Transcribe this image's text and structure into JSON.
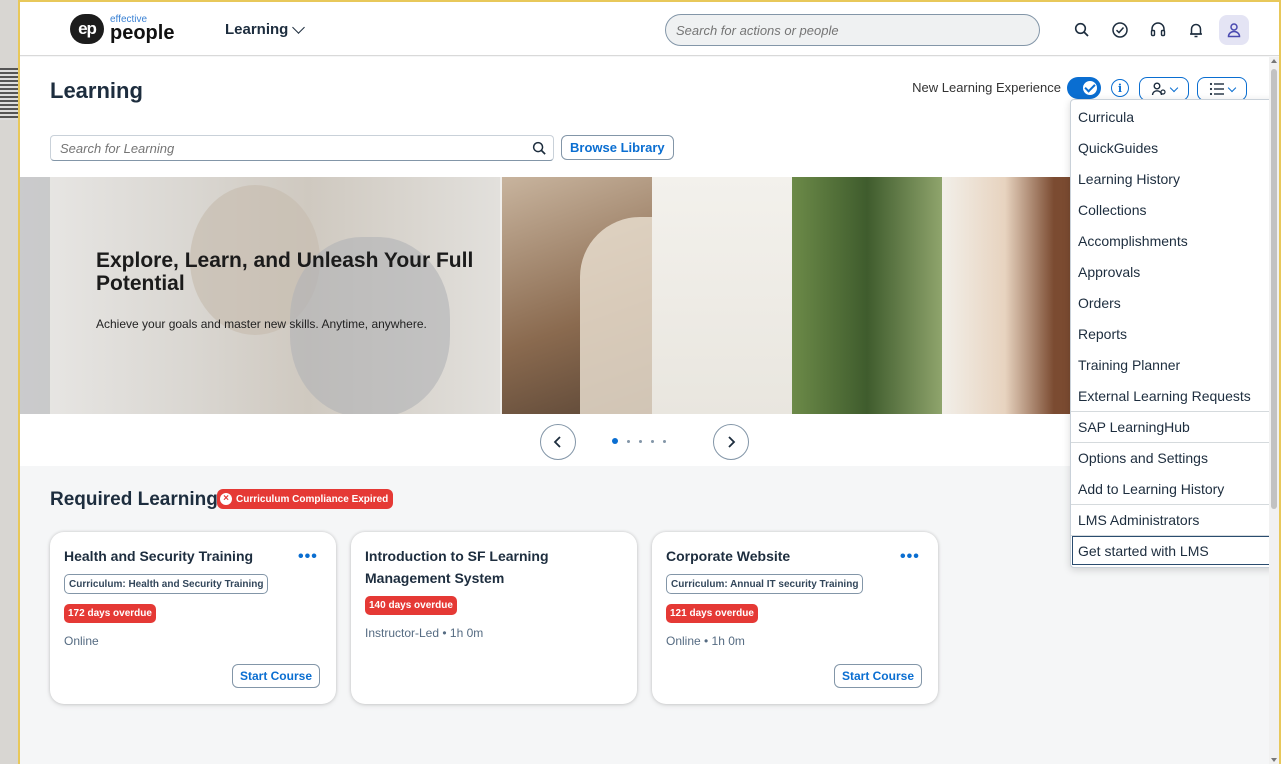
{
  "brand": {
    "logo_small": "effective",
    "logo_big": "people",
    "badge": "ep"
  },
  "shell": {
    "module": "Learning",
    "search_placeholder": "Search for actions or people",
    "icons": [
      "search-icon",
      "check-circle-icon",
      "headset-icon",
      "bell-icon",
      "user-icon"
    ]
  },
  "page": {
    "title": "Learning",
    "nle_label": "New Learning Experience",
    "nle_enabled": true,
    "search_placeholder": "Search for Learning",
    "browse_label": "Browse Library"
  },
  "hero": {
    "title": "Explore, Learn, and Unleash Your Full Potential",
    "subtitle": "Achieve your goals and master new skills. Anytime, anywhere.",
    "slide_count": 5,
    "active_slide": 1
  },
  "required": {
    "title": "Required Learning",
    "badge": "Curriculum Compliance Expired",
    "cards": [
      {
        "title": "Health and Security Training",
        "chip": "Curriculum: Health and Security Training",
        "overdue": "172 days overdue",
        "meta": "Online",
        "action": "Start Course",
        "has_more": true
      },
      {
        "title": "Introduction to SF Learning Management System",
        "chip": "",
        "overdue": "140 days overdue",
        "meta": "Instructor-Led • 1h 0m",
        "action": "",
        "has_more": false
      },
      {
        "title": "Corporate Website",
        "chip": "Curriculum: Annual IT security Training",
        "overdue": "121 days overdue",
        "meta": "Online • 1h 0m",
        "action": "Start Course",
        "has_more": true
      }
    ]
  },
  "menu": {
    "items": [
      "Curricula",
      "QuickGuides",
      "Learning History",
      "Collections",
      "Accomplishments",
      "Approvals",
      "Orders",
      "Reports",
      "Training Planner",
      "External Learning Requests",
      "SAP LearningHub",
      "Options and Settings",
      "Add to Learning History",
      "LMS Administrators",
      "Get started with LMS"
    ],
    "focused": "Get started with LMS"
  },
  "colors": {
    "accent": "#0a6ed1",
    "danger": "#e53935",
    "border_highlight": "#e8c85a"
  }
}
